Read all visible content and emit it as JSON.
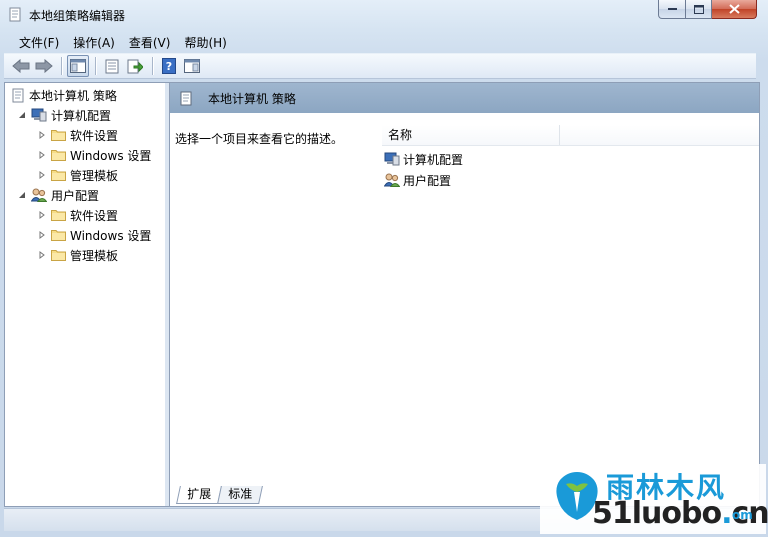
{
  "window": {
    "title": "本地组策略编辑器"
  },
  "menu": [
    "文件(F)",
    "操作(A)",
    "查看(V)",
    "帮助(H)"
  ],
  "tree": {
    "root": "本地计算机 策略",
    "computer_config": "计算机配置",
    "user_config": "用户配置",
    "software_settings": "软件设置",
    "windows_settings": "Windows 设置",
    "admin_templates": "管理模板"
  },
  "right": {
    "header": "本地计算机 策略",
    "description": "选择一个项目来查看它的描述。",
    "column_name": "名称",
    "items": [
      "计算机配置",
      "用户配置"
    ]
  },
  "tabs": [
    "扩展",
    "标准"
  ],
  "watermark": {
    "brand_cn": "雨林木风",
    "url_main": "51luobo",
    "url_dot": ".",
    "url_cn": "cn",
    "url_tail": "om"
  },
  "colors": {
    "header_band": "#9fb6cf",
    "brand_blue": "#1a9ad8"
  }
}
